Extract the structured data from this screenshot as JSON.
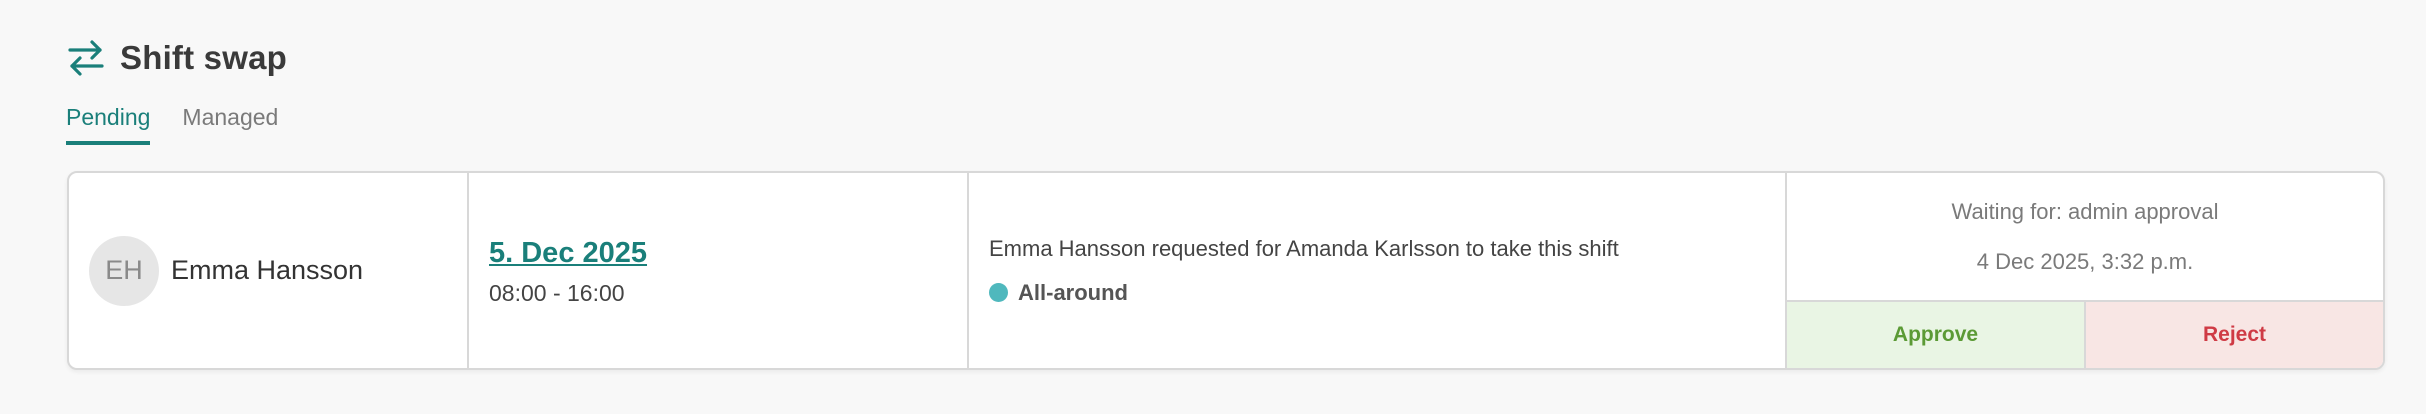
{
  "header": {
    "title": "Shift swap",
    "icon": "swap-arrows-icon",
    "accent_color": "#1a7f7a"
  },
  "tabs": [
    {
      "label": "Pending",
      "active": true
    },
    {
      "label": "Managed",
      "active": false
    }
  ],
  "request": {
    "user": {
      "initials": "EH",
      "name": "Emma Hansson"
    },
    "shift": {
      "date": "5. Dec 2025",
      "time": "08:00 - 16:00"
    },
    "description": "Emma Hansson requested for Amanda Karlsson to take this shift",
    "skill": {
      "label": "All-around",
      "color": "#4fb8bd"
    },
    "status": {
      "waiting": "Waiting for: admin approval",
      "timestamp": "4 Dec 2025, 3:32 p.m."
    },
    "actions": {
      "approve_label": "Approve",
      "reject_label": "Reject",
      "approve_color": "#5b9a35",
      "reject_color": "#cf3b45"
    }
  }
}
